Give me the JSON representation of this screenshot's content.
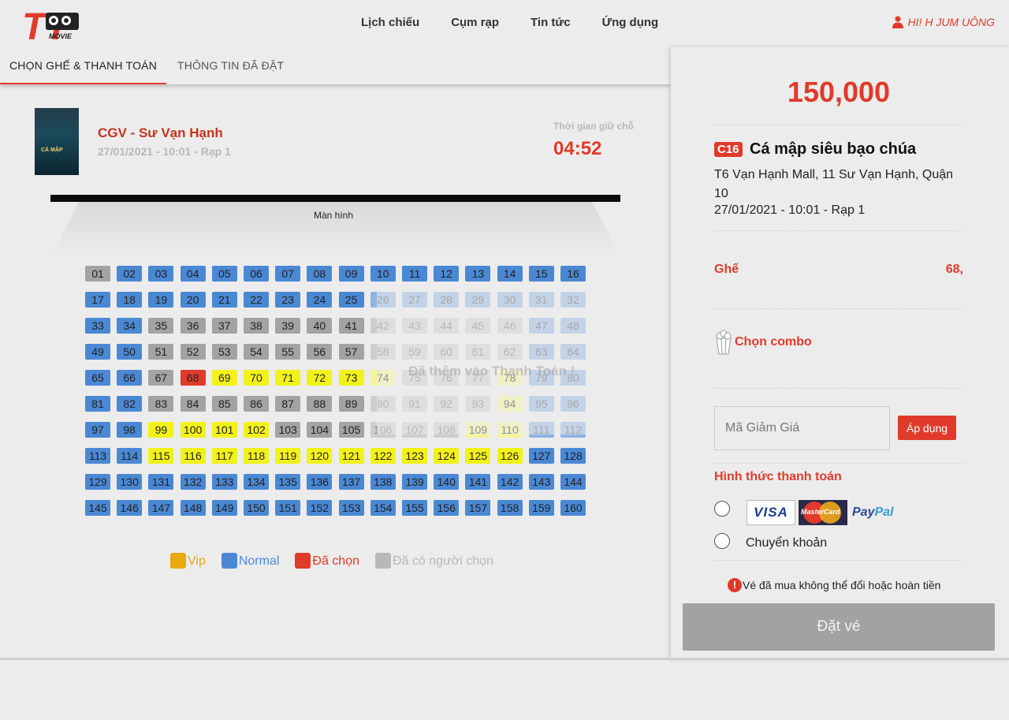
{
  "header": {
    "nav": [
      "Lịch chiếu",
      "Cụm rạp",
      "Tin tức",
      "Ứng dụng"
    ],
    "user_greeting": "HI! H JUM UÔNG"
  },
  "tabs": [
    "CHỌN GHẾ & THANH TOÁN",
    "THÔNG TIN ĐÃ ĐẶT"
  ],
  "movie_info": {
    "cinema": "CGV - Sư Vạn Hạnh",
    "datetime_room": "27/01/2021 - 10:01 - Rạp 1",
    "hold_label": "Thời gian giữ chỗ",
    "hold_time": "04:52",
    "poster_text": "CÁ MẬP"
  },
  "screen_label": "Màn hình",
  "seats": {
    "rows": 10,
    "cols": 16,
    "vip": [
      69,
      70,
      71,
      72,
      73,
      74,
      78,
      94,
      99,
      100,
      101,
      102,
      109,
      110,
      115,
      116,
      117,
      118,
      119,
      120,
      121,
      122,
      123,
      124,
      125,
      126
    ],
    "taken": [
      1,
      35,
      36,
      37,
      38,
      39,
      40,
      41,
      42,
      43,
      44,
      45,
      46,
      51,
      52,
      53,
      54,
      55,
      56,
      57,
      58,
      59,
      60,
      61,
      62,
      67,
      75,
      76,
      77,
      83,
      84,
      85,
      86,
      87,
      88,
      89,
      90,
      91,
      92,
      93,
      103,
      104,
      105,
      106,
      107,
      108
    ],
    "selected": [
      68
    ],
    "overlay_light": [
      26,
      27,
      28,
      29,
      30,
      31,
      32,
      42,
      43,
      44,
      45,
      46,
      47,
      48,
      58,
      59,
      60,
      61,
      62,
      63,
      64,
      74,
      75,
      76,
      77,
      78,
      79,
      80,
      90,
      91,
      92,
      93,
      94,
      95,
      96,
      106,
      107,
      108,
      109,
      110,
      111,
      112
    ]
  },
  "toast": "Đã thêm vào Thanh Toán !",
  "legend": [
    {
      "label": "Vip",
      "color": "#e8a90e"
    },
    {
      "label": "Normal",
      "color": "#4a88d4"
    },
    {
      "label": "Đã chọn",
      "color": "#e03a2a"
    },
    {
      "label": "Đã có người chọn",
      "color": "#b8b8b8"
    }
  ],
  "summary": {
    "price": "150,000",
    "rating": "C16",
    "title": "Cá mập siêu bạo chúa",
    "address": "T6 Vạn Hạnh Mall, 11 Sư Vạn Hạnh, Quận 10",
    "showtime": "27/01/2021 - 10:01 - Rạp 1",
    "seat_label": "Ghế",
    "seat_value": "68,",
    "combo_label": "Chọn combo",
    "promo_placeholder": "Mã Giảm Giá",
    "apply_label": "Áp dụng",
    "payment_title": "Hình thức thanh toán",
    "payment_transfer": "Chuyển khoản",
    "card_visa": "VISA",
    "card_mastercard": "MasterCard",
    "card_paypal_a": "Pay",
    "card_paypal_b": "Pal",
    "notice": "Vé đã mua không thể đổi hoặc hoàn tiền",
    "book_label": "Đặt vé"
  }
}
